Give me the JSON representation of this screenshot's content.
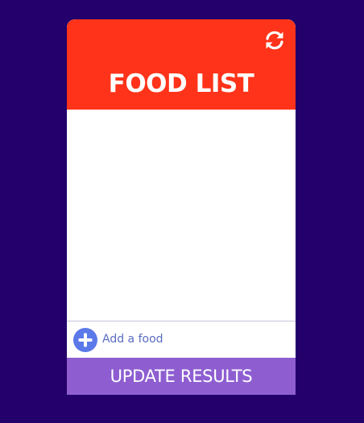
{
  "header": {
    "title": "FOOD LIST",
    "refresh_icon": "refresh-icon"
  },
  "food_list": {
    "items": []
  },
  "add_food": {
    "icon": "plus-circle-icon",
    "placeholder": "Add a food"
  },
  "footer": {
    "update_label": "UPDATE RESULTS"
  },
  "colors": {
    "background": "#23006b",
    "header": "#ff3319",
    "add_icon": "#5b79e8",
    "update_button": "#8e5ed1"
  }
}
